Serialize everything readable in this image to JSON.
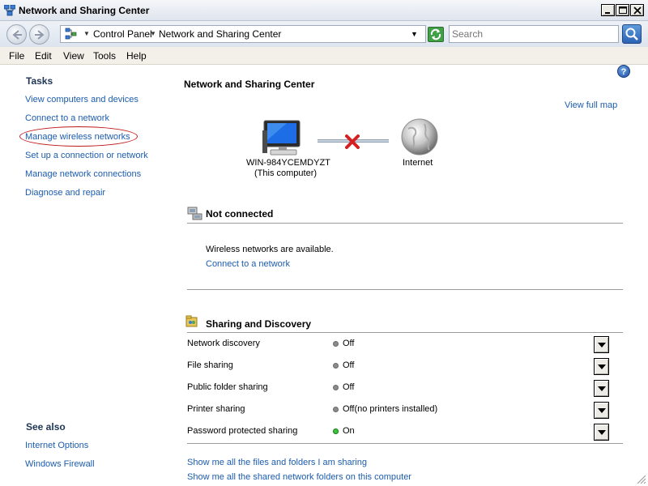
{
  "window": {
    "title": "Network and Sharing Center"
  },
  "address_bar": {
    "crumbs": [
      "Control Panel",
      "Network and Sharing Center"
    ],
    "search_placeholder": "Search"
  },
  "menu": [
    "File",
    "Edit",
    "View",
    "Tools",
    "Help"
  ],
  "tasks": {
    "heading": "Tasks",
    "items": [
      "View computers and devices",
      "Connect to a network",
      "Manage wireless networks",
      "Set up a connection or network",
      "Manage network connections",
      "Diagnose and repair"
    ]
  },
  "see_also": {
    "heading": "See also",
    "items": [
      "Internet Options",
      "Windows Firewall"
    ]
  },
  "main": {
    "title": "Network and Sharing Center",
    "view_full_map": "View full map",
    "computer_name": "WIN-984YCEMDYZT",
    "computer_sub": "(This computer)",
    "internet_label": "Internet"
  },
  "network_status": {
    "title": "Not connected",
    "message": "Wireless networks are available.",
    "connect_link": "Connect to a network"
  },
  "sharing": {
    "title": "Sharing and Discovery",
    "rows": [
      {
        "label": "Network discovery",
        "value": "Off",
        "state": "off"
      },
      {
        "label": "File sharing",
        "value": "Off",
        "state": "off"
      },
      {
        "label": "Public folder sharing",
        "value": "Off",
        "state": "off"
      },
      {
        "label": "Printer sharing",
        "value": "Off(no printers installed)",
        "state": "off"
      },
      {
        "label": "Password protected sharing",
        "value": "On",
        "state": "on"
      }
    ]
  },
  "bottom_links": [
    "Show me all the files and folders I am sharing",
    "Show me all the shared network folders on this computer"
  ],
  "colors": {
    "link": "#1c5cae",
    "status_on": "#39c439",
    "status_off": "#8b8b8b",
    "annotation_circle": "#c01818"
  }
}
